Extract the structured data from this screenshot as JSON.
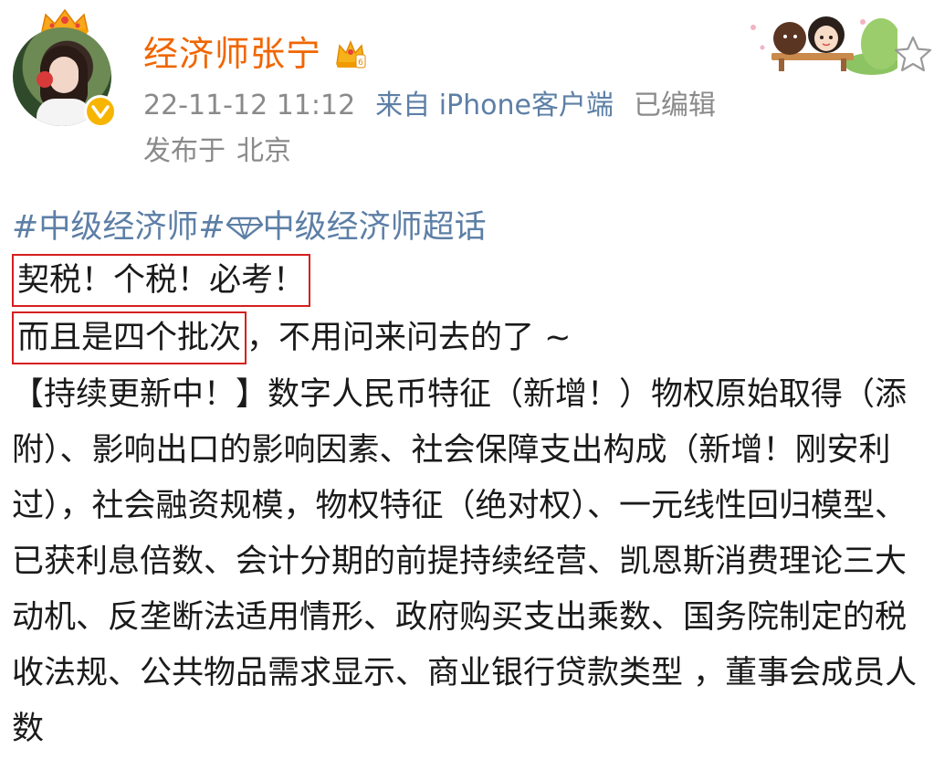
{
  "post": {
    "author": {
      "name": "经济师张宁",
      "avatar_icon": "user-avatar",
      "verified_icon": "verified-badge-icon",
      "crown_icon": "crown-icon",
      "vip_icon": "vip-crown-icon",
      "name_color": "#f06600"
    },
    "meta": {
      "time": "22-11-12 11:12",
      "source": "来自 iPhone客户端",
      "edited": "已编辑"
    },
    "location": {
      "label": "发布于",
      "city": "北京"
    },
    "topics": {
      "hashtag": "#中级经济师#",
      "supertopic_icon": "diamond-icon",
      "supertopic": "中级经济师超话",
      "color": "#5d7fa6"
    },
    "content": {
      "line1": "契税！个税！必考！",
      "line2_boxed": "而且是四个批次",
      "line2_rest": "，不用问来问去的了 ~",
      "paragraph": "【持续更新中！】数字人民币特征（新增！）物权原始取得（添附）、影响出口的影响因素、社会保障支出构成（新增！刚安利过），社会融资规模，物权特征（绝对权）、一元线性回归模型、已获利息倍数、会计分期的前提持续经营、凯恩斯消费理论三大动机、反垄断法适用情形、政府购买支出乘数、国务院制定的税收法规、公共物品需求显示、商业银行贷款类型 ，董事会成员人数"
    },
    "highlight_color": "#d61f1f",
    "favorite_icon": "star-outline-icon",
    "decoration_icon": "cartoon-couple-icon"
  }
}
